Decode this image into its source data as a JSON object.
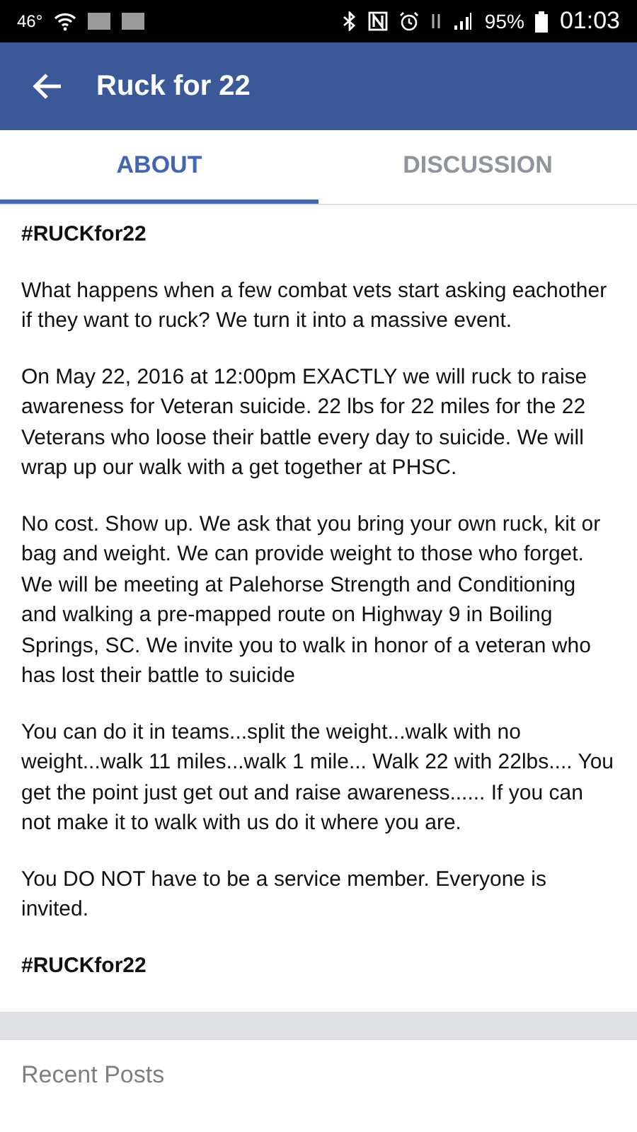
{
  "status_bar": {
    "temperature": "46°",
    "battery": "95%",
    "time": "01:03"
  },
  "header": {
    "title": "Ruck for 22"
  },
  "tabs": [
    {
      "label": "ABOUT",
      "selected": true
    },
    {
      "label": "DISCUSSION",
      "selected": false
    }
  ],
  "about": {
    "paragraphs": [
      {
        "kind": "hashtag",
        "text": "#RUCKfor22"
      },
      {
        "kind": "text",
        "text": "What happens when a few combat vets start asking eachother if they want to ruck? We turn it into a massive event."
      },
      {
        "kind": "text",
        "text": "On May 22, 2016 at 12:00pm EXACTLY we will ruck to raise awareness for Veteran suicide. 22 lbs for 22 miles for  the 22 Veterans who loose their battle every day to suicide. We will wrap up our walk with a get together at PHSC."
      },
      {
        "kind": "text",
        "text": "No cost. Show up. We ask that you bring your own ruck, kit or bag and weight. We can provide weight to those who forget. We will be meeting at Palehorse Strength and Conditioning and walking a pre-mapped route on Highway 9 in Boiling Springs, SC. We invite you to walk in honor of a veteran who has lost their battle to suicide"
      },
      {
        "kind": "text",
        "text": "You can do it in teams...split the weight...walk with no weight...walk 11 miles...walk 1 mile... Walk 22 with 22lbs.... You get the point just get out and raise awareness......  If you can not make it to walk with us do it where you are."
      },
      {
        "kind": "text",
        "text": "You DO NOT have to be a service member. Everyone is invited."
      },
      {
        "kind": "hashtag",
        "text": "#RUCKfor22"
      }
    ]
  },
  "recent_posts": {
    "title": "Recent Posts"
  }
}
